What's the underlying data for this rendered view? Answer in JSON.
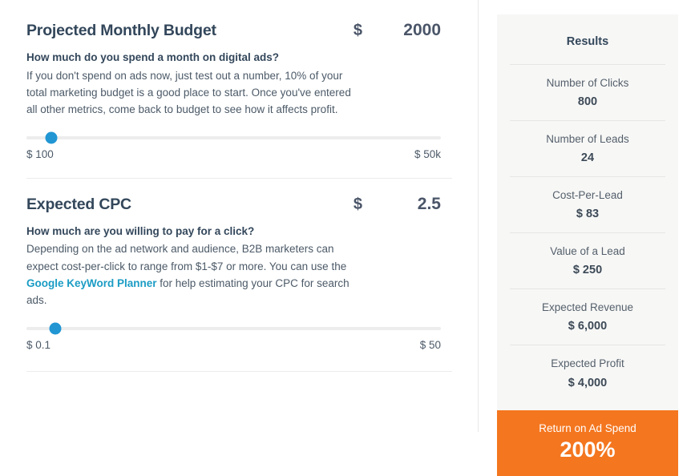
{
  "metrics": [
    {
      "title": "Projected Monthly Budget",
      "currency": "$",
      "value": "2000",
      "question": "How much do you spend a month on digital ads?",
      "description_before": "If you don't spend on ads now, just test out a number, 10% of your total marketing budget is a good place to start. Once you've entered all other metrics, come back to budget to see how it affects profit.",
      "link_text": "",
      "description_after": "",
      "slider": {
        "min_label": "$ 100",
        "max_label": "$ 50k",
        "fill_percent": 6
      }
    },
    {
      "title": "Expected CPC",
      "currency": "$",
      "value": "2.5",
      "question": "How much are you willing to pay for a click?",
      "description_before": "Depending on the ad network and audience, B2B marketers can expect cost-per-click to range from $1-$7 or more. You can use the ",
      "link_text": "Google KeyWord Planner",
      "description_after": " for help estimating your CPC for search ads.",
      "slider": {
        "min_label": "$ 0.1",
        "max_label": "$ 50",
        "fill_percent": 7
      }
    }
  ],
  "results": {
    "title": "Results",
    "rows": [
      {
        "label": "Number of Clicks",
        "value": "800"
      },
      {
        "label": "Number of Leads",
        "value": "24"
      },
      {
        "label": "Cost-Per-Lead",
        "value": "$ 83"
      },
      {
        "label": "Value of a Lead",
        "value": "$ 250"
      },
      {
        "label": "Expected Revenue",
        "value": "$ 6,000"
      },
      {
        "label": "Expected Profit",
        "value": "$ 4,000"
      }
    ],
    "highlight": {
      "label": "Return on Ad Spend",
      "value": "200%",
      "background_color": "#f4761f"
    }
  },
  "colors": {
    "heading": "#33475b",
    "accent_blue": "#2196d3",
    "link": "#1b9cc4",
    "orange": "#f4761f",
    "panel_bg": "#f7f7f6"
  }
}
